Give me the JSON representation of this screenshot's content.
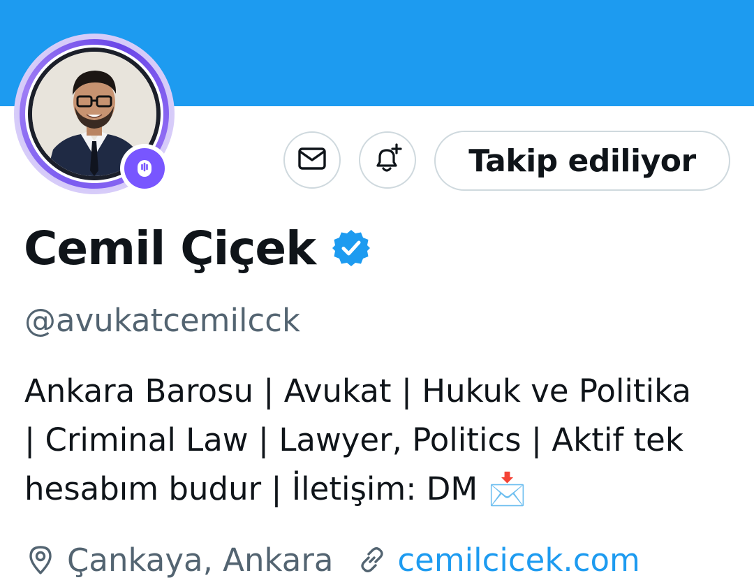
{
  "colors": {
    "banner": "#1d9bf0",
    "link": "#1d9bf0",
    "muted": "#536471",
    "text": "#0f1419",
    "border": "#cfd9de",
    "spaces_accent": "#7856ff"
  },
  "profile": {
    "name": "Cemil Çiçek",
    "handle": "@avukatcemilcck",
    "verified_icon": "verified-badge-icon",
    "avatar_status_icon": "spaces-microphone-icon",
    "bio_lines": [
      "Ankara Barosu | Avukat | Hukuk ve Politika",
      "| Criminal Law | Lawyer, Politics | Aktif tek",
      "hesabım budur | İletişim: DM 📩"
    ],
    "location": "Çankaya, Ankara",
    "website": "cemilcicek.com"
  },
  "actions": {
    "message_icon": "envelope-icon",
    "notify_icon": "bell-plus-icon",
    "follow_label": "Takip ediliyor"
  }
}
